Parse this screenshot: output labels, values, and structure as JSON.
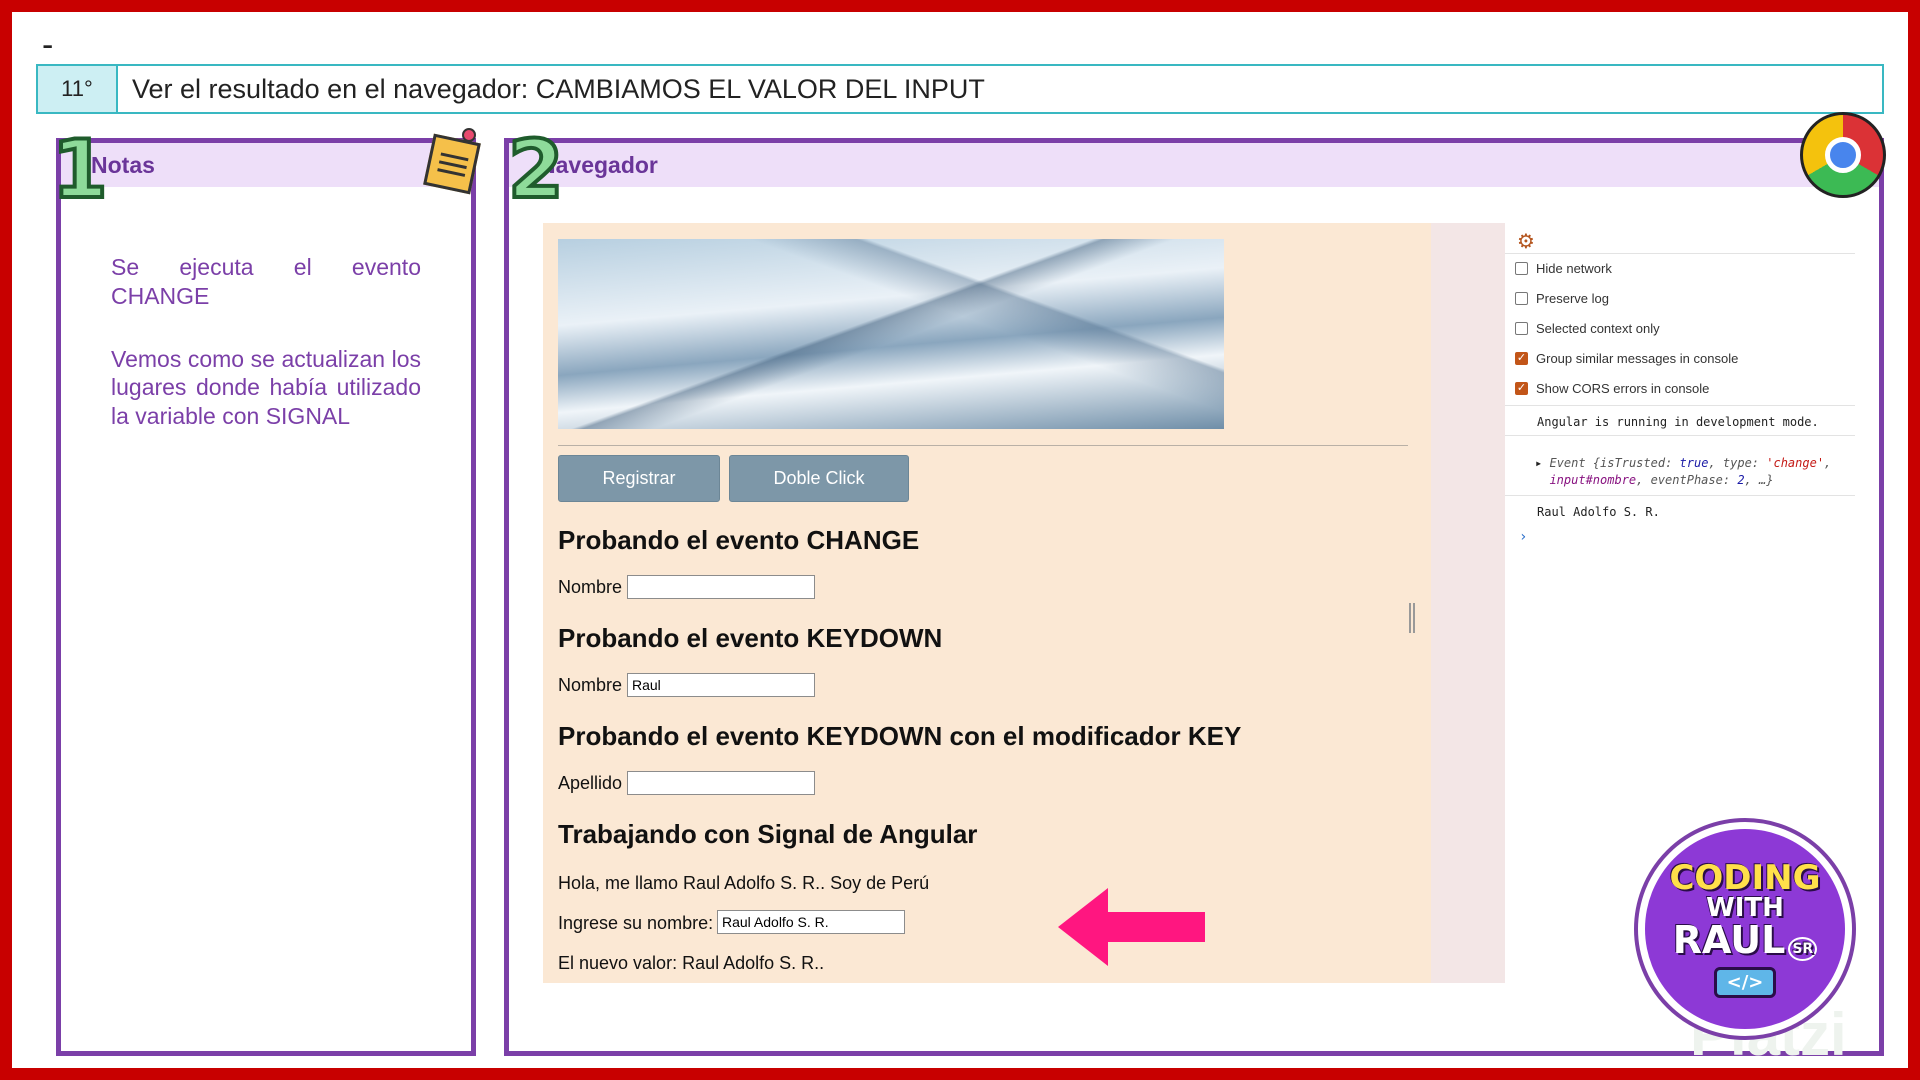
{
  "header": {
    "dash": "-",
    "step_number": "11°",
    "step_title": "Ver el resultado en el navegador: CAMBIAMOS EL VALOR DEL INPUT"
  },
  "notes_panel": {
    "number": "1",
    "title": "Notas",
    "paragraphs": [
      "Se ejecuta el evento CHANGE",
      "Vemos como se actualizan los lugares donde había utilizado la variable con SIGNAL"
    ]
  },
  "nav_panel": {
    "number": "2",
    "title": "Navegador"
  },
  "page": {
    "buttons": {
      "register": "Registrar",
      "double_click": "Doble Click"
    },
    "sections": [
      {
        "title": "Probando el evento CHANGE",
        "label": "Nombre",
        "value": ""
      },
      {
        "title": "Probando el evento KEYDOWN",
        "label": "Nombre",
        "value": "Raul"
      },
      {
        "title": "Probando el evento KEYDOWN con el modificador KEY",
        "label": "Apellido",
        "value": ""
      }
    ],
    "signal": {
      "title": "Trabajando con Signal de Angular",
      "greeting": "Hola, me llamo Raul Adolfo S. R.. Soy de Perú",
      "input_label": "Ingrese su nombre:",
      "input_value": "Raul Adolfo S. R.",
      "result": "El nuevo valor: Raul Adolfo S. R.."
    }
  },
  "devtools": {
    "options": [
      {
        "label": "Hide network",
        "checked": false
      },
      {
        "label": "Preserve log",
        "checked": false
      },
      {
        "label": "Selected context only",
        "checked": false
      },
      {
        "label": "Group similar messages in console",
        "checked": true
      },
      {
        "label": "Show CORS errors in console",
        "checked": true
      }
    ],
    "console": {
      "line1": "Angular is running in development mode.",
      "event_prefix": "Event {",
      "k_trusted": "isTrusted",
      "v_trusted": "true",
      "k_type": "type",
      "v_type": "'change'",
      "v_target": "input#nombre",
      "k_phase": "eventPhase",
      "v_phase": "2",
      "event_suffix": "…}",
      "line3": "Raul Adolfo S. R.",
      "prompt": "›"
    }
  },
  "badge": {
    "line1": "CODING",
    "line2": "WITH",
    "line3": "RAUL",
    "tag": "SR",
    "icon": "</>"
  },
  "watermark": "Platzi",
  "colors": {
    "frame": "#c80000",
    "panel_border": "#7b3fa8",
    "step_border": "#39b8c2",
    "arrow": "#ff1680"
  }
}
